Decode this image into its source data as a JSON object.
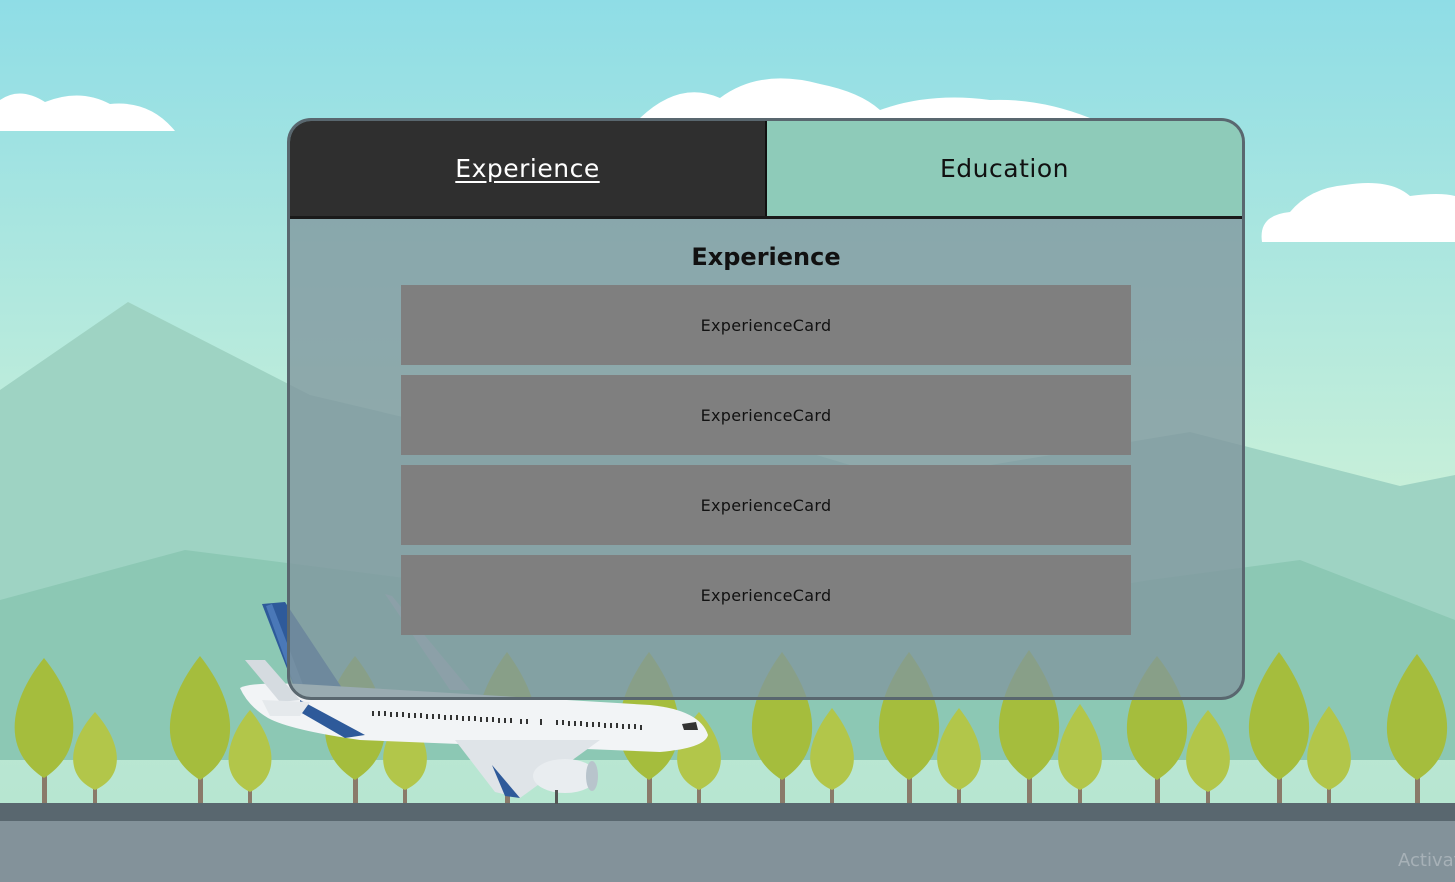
{
  "tabs": [
    {
      "label": "Experience",
      "active": true
    },
    {
      "label": "Education",
      "active": false
    }
  ],
  "section": {
    "title": "Experience"
  },
  "cards": [
    {
      "label": "ExperienceCard"
    },
    {
      "label": "ExperienceCard"
    },
    {
      "label": "ExperienceCard"
    },
    {
      "label": "ExperienceCard"
    }
  ],
  "watermark": "Activat",
  "colors": {
    "sky_top": "#8fdde6",
    "sky_bottom": "#c6efd9",
    "active_tab": "#2f2f2f",
    "inactive_tab": "#8ecbb9",
    "card": "#7f7f7f",
    "panel_border": "#59676f",
    "runway": "#83929a"
  }
}
